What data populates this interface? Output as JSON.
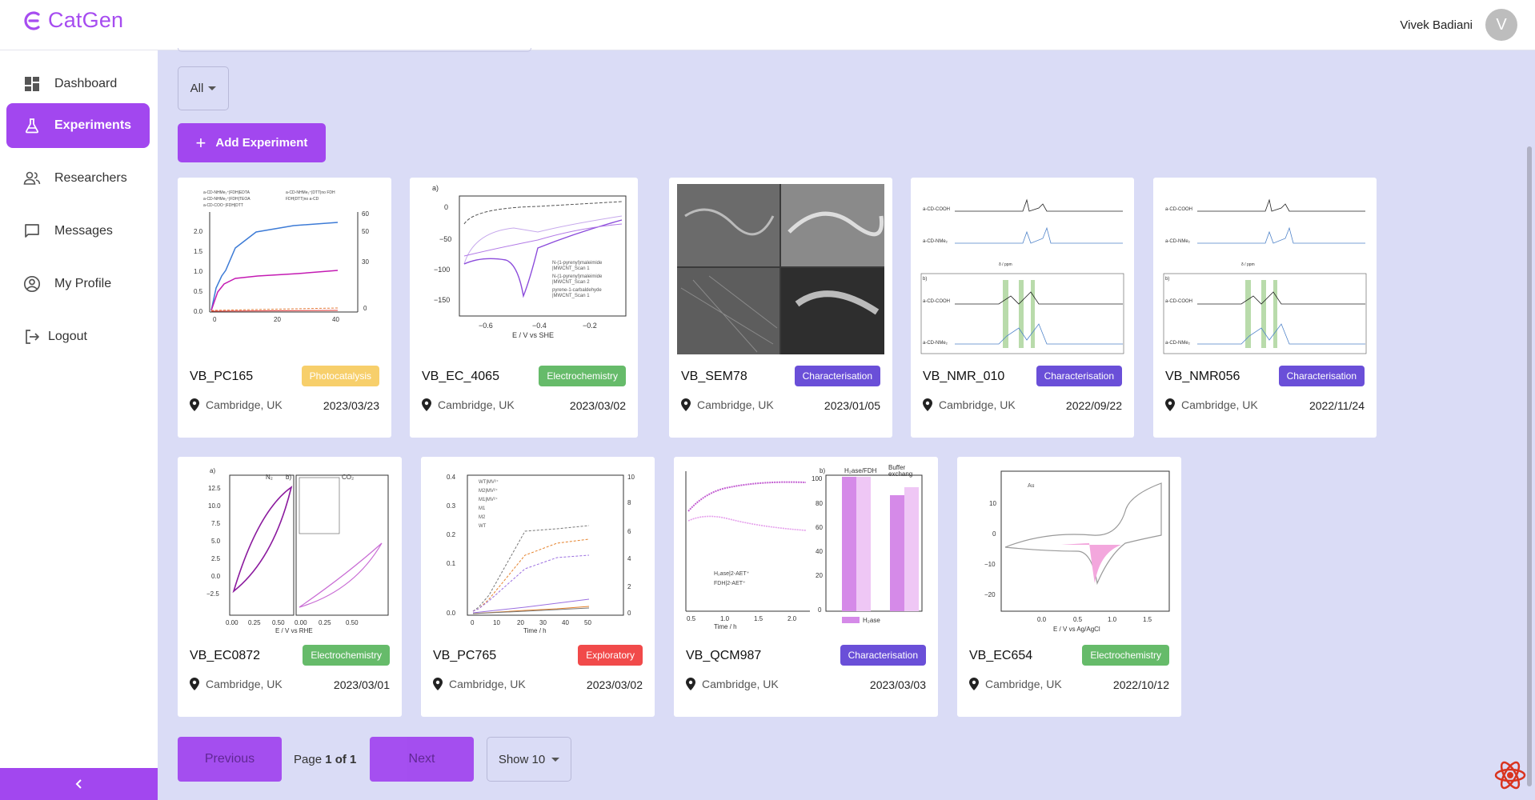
{
  "app": {
    "name": "CatGen",
    "brand_color": "#a247ef"
  },
  "user": {
    "name": "Vivek Badiani",
    "initial": "V"
  },
  "sidebar": {
    "items": [
      {
        "label": "Dashboard",
        "icon": "dashboard-icon",
        "active": false
      },
      {
        "label": "Experiments",
        "icon": "flask-icon",
        "active": true
      },
      {
        "label": "Researchers",
        "icon": "people-icon",
        "active": false
      },
      {
        "label": "Messages",
        "icon": "chat-icon",
        "active": false
      },
      {
        "label": "My Profile",
        "icon": "account-circle-icon",
        "active": false
      },
      {
        "label": "Logout",
        "icon": "logout-icon",
        "active": false
      }
    ],
    "collapse_icon": "chevron-left-icon"
  },
  "filter": {
    "selected": "All"
  },
  "toolbar": {
    "add_label": "Add Experiment"
  },
  "categories": {
    "Photocatalysis": "#f7cf6b",
    "Electrochemistry": "#66bb6a",
    "Characterisation": "#6a4fd8",
    "Exploratory": "#f14a4a"
  },
  "experiments": [
    {
      "name": "VB_PC165",
      "category": "Photocatalysis",
      "location": "Cambridge, UK",
      "date": "2023/03/23"
    },
    {
      "name": "VB_EC_4065",
      "category": "Electrochemistry",
      "location": "Cambridge, UK",
      "date": "2023/03/02"
    },
    {
      "name": "VB_SEM78",
      "category": "Characterisation",
      "location": "Cambridge, UK",
      "date": "2023/01/05"
    },
    {
      "name": "VB_NMR_010",
      "category": "Characterisation",
      "location": "Cambridge, UK",
      "date": "2022/09/22"
    },
    {
      "name": "VB_NMR056",
      "category": "Characterisation",
      "location": "Cambridge, UK",
      "date": "2022/11/24"
    },
    {
      "name": "VB_EC0872",
      "category": "Electrochemistry",
      "location": "Cambridge, UK",
      "date": "2023/03/01"
    },
    {
      "name": "VB_PC765",
      "category": "Exploratory",
      "location": "Cambridge, UK",
      "date": "2023/03/02"
    },
    {
      "name": "VB_QCM987",
      "category": "Characterisation",
      "location": "Cambridge, UK",
      "date": "2023/03/03"
    },
    {
      "name": "VB_EC654",
      "category": "Electrochemistry",
      "location": "Cambridge, UK",
      "date": "2022/10/12"
    }
  ],
  "pagination": {
    "previous_label": "Previous",
    "page_prefix": "Page",
    "page_current": "1 of 1",
    "next_label": "Next",
    "show_label": "Show 10"
  }
}
